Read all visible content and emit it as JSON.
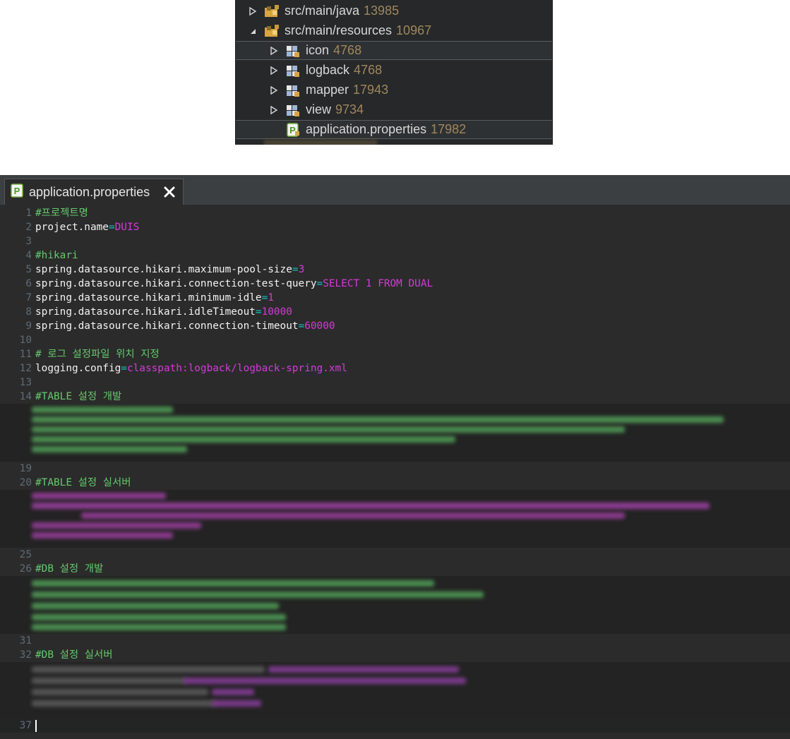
{
  "tree": {
    "rows": [
      {
        "label": "src/main/java",
        "count": "13985",
        "expanded": false,
        "icon": "package-folder-icon"
      },
      {
        "label": "src/main/resources",
        "count": "10967",
        "expanded": true,
        "icon": "package-folder-icon"
      },
      {
        "label": "icon",
        "count": "4768",
        "expanded": false,
        "icon": "folder-icon"
      },
      {
        "label": "logback",
        "count": "4768",
        "expanded": false,
        "icon": "folder-icon"
      },
      {
        "label": "mapper",
        "count": "17943",
        "expanded": false,
        "icon": "folder-icon"
      },
      {
        "label": "view",
        "count": "9734",
        "expanded": false,
        "icon": "folder-icon"
      },
      {
        "label": "application.properties",
        "count": "17982",
        "icon": "properties-file-icon"
      }
    ]
  },
  "editor": {
    "tab": {
      "title": "application.properties",
      "icon": "properties-file-icon",
      "close": "close-icon"
    },
    "lines": [
      {
        "n": "1",
        "comment": "#프로젝트명"
      },
      {
        "n": "2",
        "key": "project.name",
        "value": "DUIS"
      },
      {
        "n": "3"
      },
      {
        "n": "4",
        "comment": "#hikari"
      },
      {
        "n": "5",
        "key": "spring.datasource.hikari.maximum-pool-size",
        "value": "3"
      },
      {
        "n": "6",
        "key": "spring.datasource.hikari.connection-test-query",
        "value": "SELECT 1 FROM DUAL"
      },
      {
        "n": "7",
        "key": "spring.datasource.hikari.minimum-idle",
        "value": "1"
      },
      {
        "n": "8",
        "key": "spring.datasource.hikari.idleTimeout",
        "value": "10000"
      },
      {
        "n": "9",
        "key": "spring.datasource.hikari.connection-timeout",
        "value": "60000"
      },
      {
        "n": "10"
      },
      {
        "n": "11",
        "comment": "# 로그 설정파일 위치 지정"
      },
      {
        "n": "12",
        "key": "logging.config",
        "value": "classpath:logback/logback-spring.xml"
      },
      {
        "n": "13"
      },
      {
        "n": "14",
        "comment": "#TABLE 설정 개발"
      },
      {
        "n": "19"
      },
      {
        "n": "20",
        "comment": "#TABLE 설정 실서버"
      },
      {
        "n": "25"
      },
      {
        "n": "26",
        "comment": "#DB 설정 개발"
      },
      {
        "n": "31"
      },
      {
        "n": "32",
        "comment": "#DB 설정 실서버"
      },
      {
        "n": "37"
      }
    ]
  },
  "colors": {
    "key": "#f2f2f2",
    "equals": "#12c4c4",
    "value": "#d43bd7",
    "comment": "#64c96d",
    "count": "#a0875e"
  }
}
